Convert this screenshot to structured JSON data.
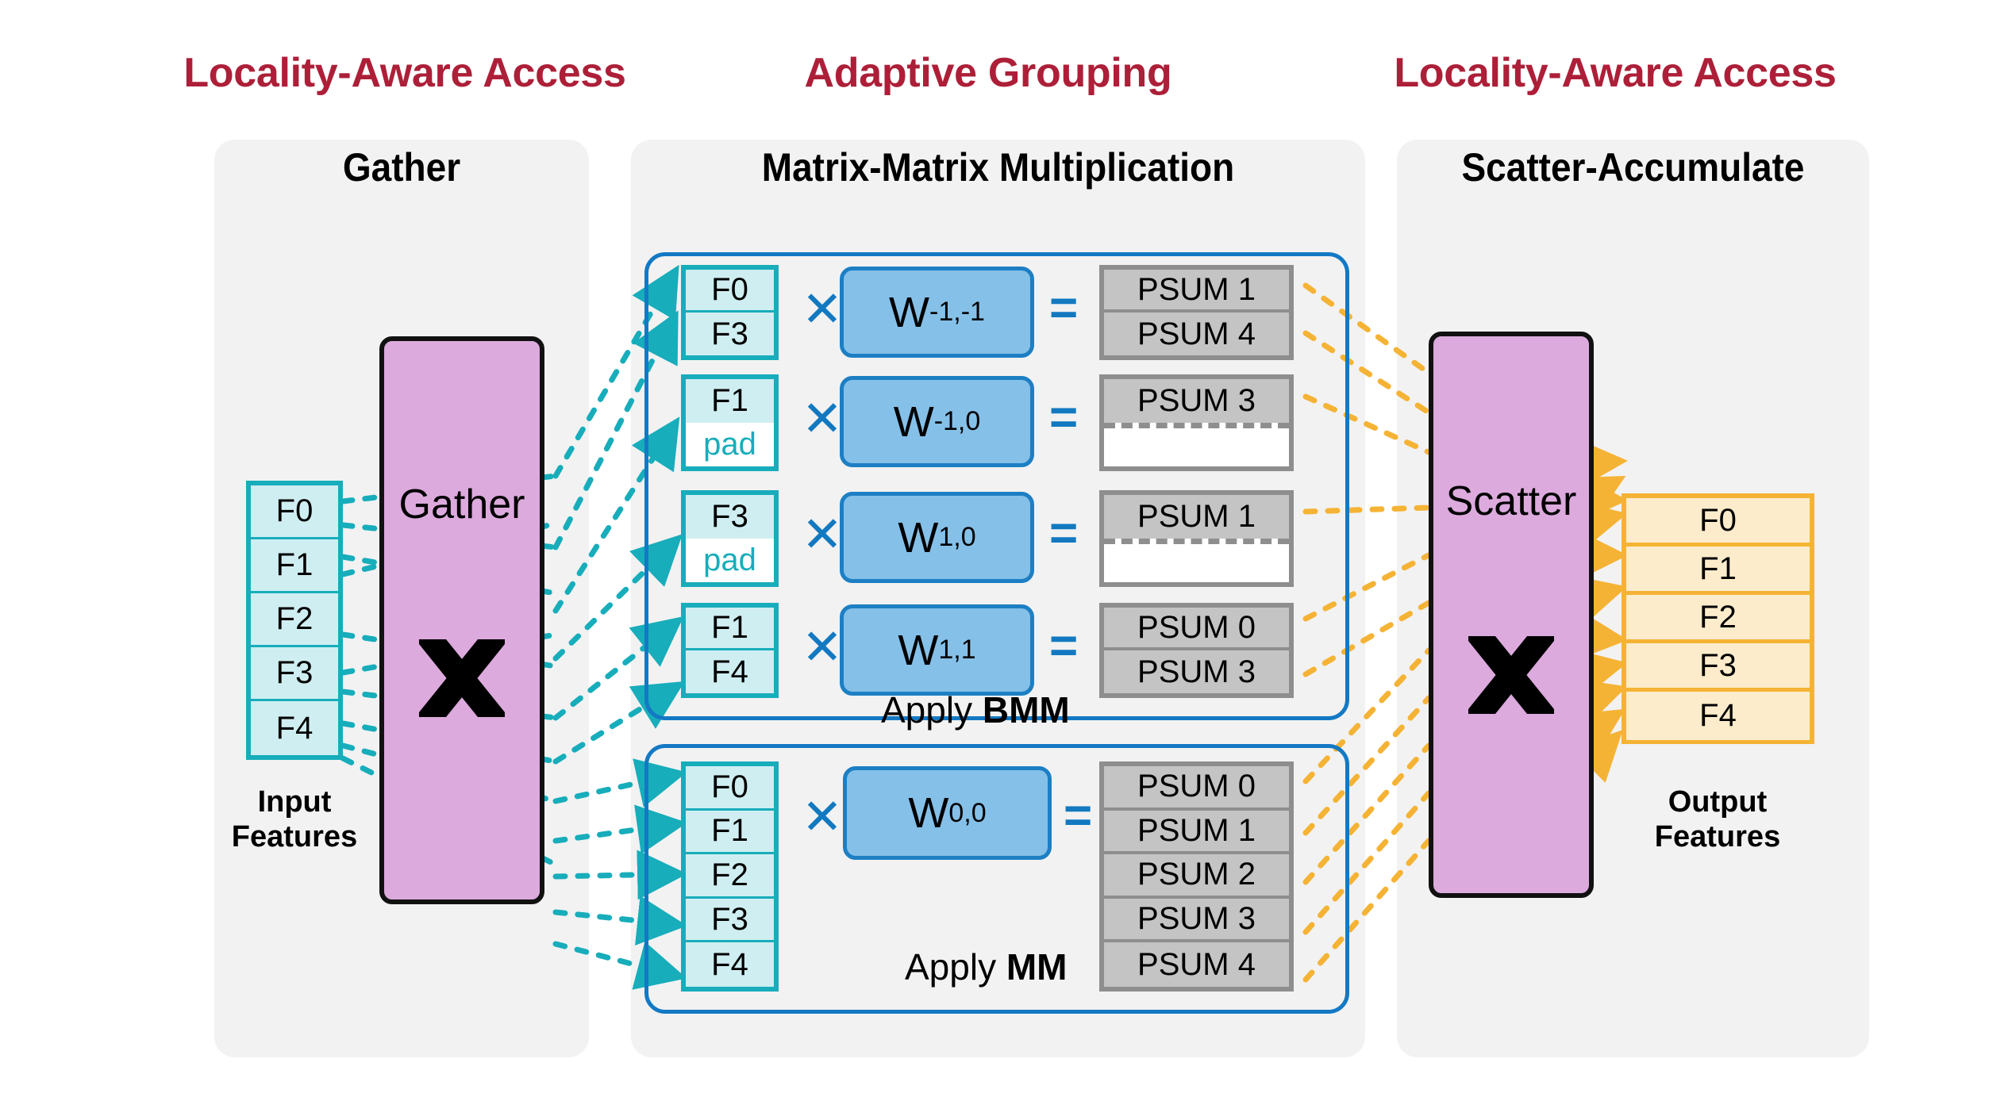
{
  "headers": [
    {
      "label": "Locality-Aware Access",
      "color": "#ad1f38"
    },
    {
      "label": "Adaptive Grouping",
      "color": "#ad1f38"
    },
    {
      "label": "Locality-Aware Access",
      "color": "#ad1f38"
    }
  ],
  "panels": [
    {
      "title": "Gather"
    },
    {
      "title": "Matrix-Matrix Multiplication"
    },
    {
      "title": "Scatter-Accumulate"
    }
  ],
  "input_features": {
    "caption": "Input Features",
    "cells": [
      "F0",
      "F1",
      "F2",
      "F3",
      "F4"
    ]
  },
  "output_features": {
    "caption": "Output Features",
    "cells": [
      "F0",
      "F1",
      "F2",
      "F3",
      "F4"
    ]
  },
  "gather": {
    "label": "Gather",
    "icon": "crossbar-x-icon"
  },
  "scatter": {
    "label": "Scatter",
    "icon": "crossbar-x-icon"
  },
  "operators": {
    "multiply": "✕",
    "equals": "="
  },
  "bmm_group": {
    "apply_prefix": "Apply ",
    "apply_name": "BMM",
    "rows": [
      {
        "features": [
          "F0",
          "F3"
        ],
        "pad": false,
        "weight": "W",
        "weight_sub": "-1,-1",
        "psums": [
          "PSUM 1",
          "PSUM 4"
        ],
        "psum_empty": false
      },
      {
        "features": [
          "F1",
          "pad"
        ],
        "pad": true,
        "weight": "W",
        "weight_sub": "-1,0",
        "psums": [
          "PSUM 3",
          ""
        ],
        "psum_empty": true
      },
      {
        "features": [
          "F3",
          "pad"
        ],
        "pad": true,
        "weight": "W",
        "weight_sub": "1,0",
        "psums": [
          "PSUM 1",
          ""
        ],
        "psum_empty": true
      },
      {
        "features": [
          "F1",
          "F4"
        ],
        "pad": false,
        "weight": "W",
        "weight_sub": "1,1",
        "psums": [
          "PSUM 0",
          "PSUM 3"
        ],
        "psum_empty": false
      }
    ]
  },
  "mm_group": {
    "apply_prefix": "Apply ",
    "apply_name": "MM",
    "features": [
      "F0",
      "F1",
      "F2",
      "F3",
      "F4"
    ],
    "weight": "W",
    "weight_sub": "0,0",
    "psums": [
      "PSUM 0",
      "PSUM 1",
      "PSUM 2",
      "PSUM 3",
      "PSUM 4"
    ]
  },
  "colors": {
    "accent_red": "#ad1f38",
    "panel_bg": "#f2f2f2",
    "feature_fill": "#cfeef1",
    "feature_border": "#17adbb",
    "gather_fill": "#dcaadd",
    "weight_fill": "#85c0e8",
    "weight_border": "#1d7fc4",
    "psum_fill": "#c4c4c4",
    "psum_border": "#8e8e8e",
    "output_fill": "#fdeccb",
    "output_border": "#f5b335",
    "group_border": "#1379c4"
  }
}
